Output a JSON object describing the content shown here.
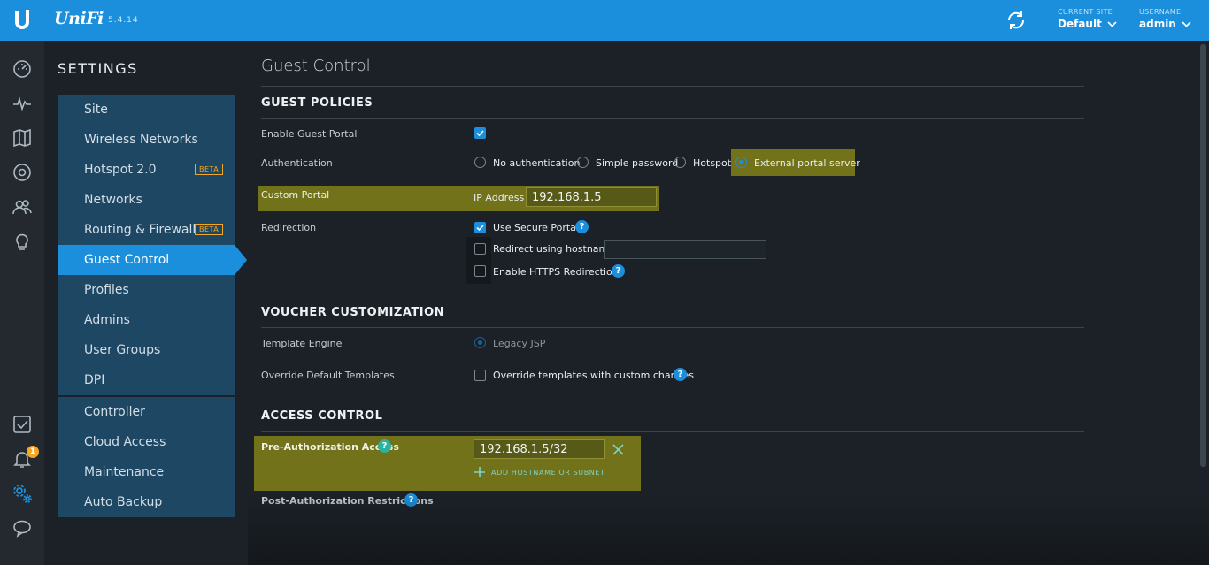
{
  "header": {
    "brand": "UniFi",
    "version": "5.4.14",
    "current_site_caption": "CURRENT SITE",
    "current_site": "Default",
    "username_caption": "USERNAME",
    "username": "admin",
    "brand_color": "#1c8fdc"
  },
  "rail": {
    "icons": [
      "dashboard-icon",
      "statistics-icon",
      "map-icon",
      "devices-icon",
      "clients-icon",
      "insights-icon",
      "tasks-icon",
      "alerts-icon",
      "settings-icon",
      "chat-icon"
    ],
    "alert_count": "1"
  },
  "settings": {
    "title": "SETTINGS",
    "group1": [
      {
        "label": "Site"
      },
      {
        "label": "Wireless Networks"
      },
      {
        "label": "Hotspot 2.0",
        "badge": "BETA"
      },
      {
        "label": "Networks"
      },
      {
        "label": "Routing & Firewall",
        "badge": "BETA"
      },
      {
        "label": "Guest Control",
        "active": true
      },
      {
        "label": "Profiles"
      },
      {
        "label": "Admins"
      },
      {
        "label": "User Groups"
      },
      {
        "label": "DPI"
      }
    ],
    "group2": [
      {
        "label": "Controller"
      },
      {
        "label": "Cloud Access"
      },
      {
        "label": "Maintenance"
      },
      {
        "label": "Auto Backup"
      }
    ]
  },
  "main": {
    "title": "Guest Control",
    "guest_policies": {
      "heading": "GUEST POLICIES",
      "enable_portal_label": "Enable Guest Portal",
      "authentication_label": "Authentication",
      "auth_options": [
        "No authentication",
        "Simple password",
        "Hotspot",
        "External portal server"
      ],
      "auth_selected": "External portal server",
      "custom_portal_label": "Custom Portal",
      "ip_address_label": "IP Address",
      "ip_address": "192.168.1.5",
      "redirection_label": "Redirection",
      "use_secure_portal": "Use Secure Portal",
      "redirect_hostname": "Redirect using hostname",
      "https_redirection": "Enable HTTPS Redirection"
    },
    "voucher": {
      "heading": "VOUCHER CUSTOMIZATION",
      "template_engine_label": "Template Engine",
      "template_engine_value": "Legacy JSP",
      "override_label": "Override Default Templates",
      "override_checkbox": "Override templates with custom changes"
    },
    "access": {
      "heading": "ACCESS CONTROL",
      "pre_auth_label": "Pre-Authorization Access",
      "pre_auth_value": "192.168.1.5/32",
      "add_link": "ADD HOSTNAME OR SUBNET",
      "post_auth_label": "Post-Authorization Restrictions"
    }
  }
}
